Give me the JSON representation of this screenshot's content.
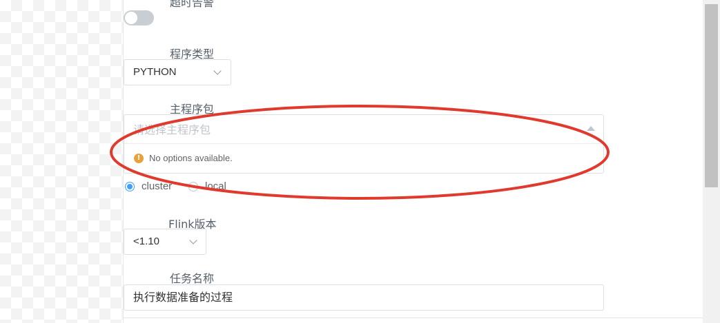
{
  "form": {
    "timeout_label": "超时告警",
    "program_type_label": "程序类型",
    "program_type_value": "PYTHON",
    "main_package_label": "主程序包",
    "main_package_placeholder": "请选择主程序包",
    "no_options_text": "No options available.",
    "deploy_modes": [
      {
        "label": "cluster",
        "checked": true
      },
      {
        "label": "local",
        "checked": false
      }
    ],
    "flink_version_label": "Flink版本",
    "flink_version_value": "<1.10",
    "task_name_label": "任务名称",
    "task_name_value": "执行数据准备的过程"
  },
  "icons": {
    "warning": "warning-icon",
    "chevron": "chevron-down-icon",
    "caret": "caret-up-icon"
  },
  "colors": {
    "annotation_ellipse": "#e03a2e",
    "radio_checked": "#409eff",
    "warning": "#e6a23c"
  }
}
